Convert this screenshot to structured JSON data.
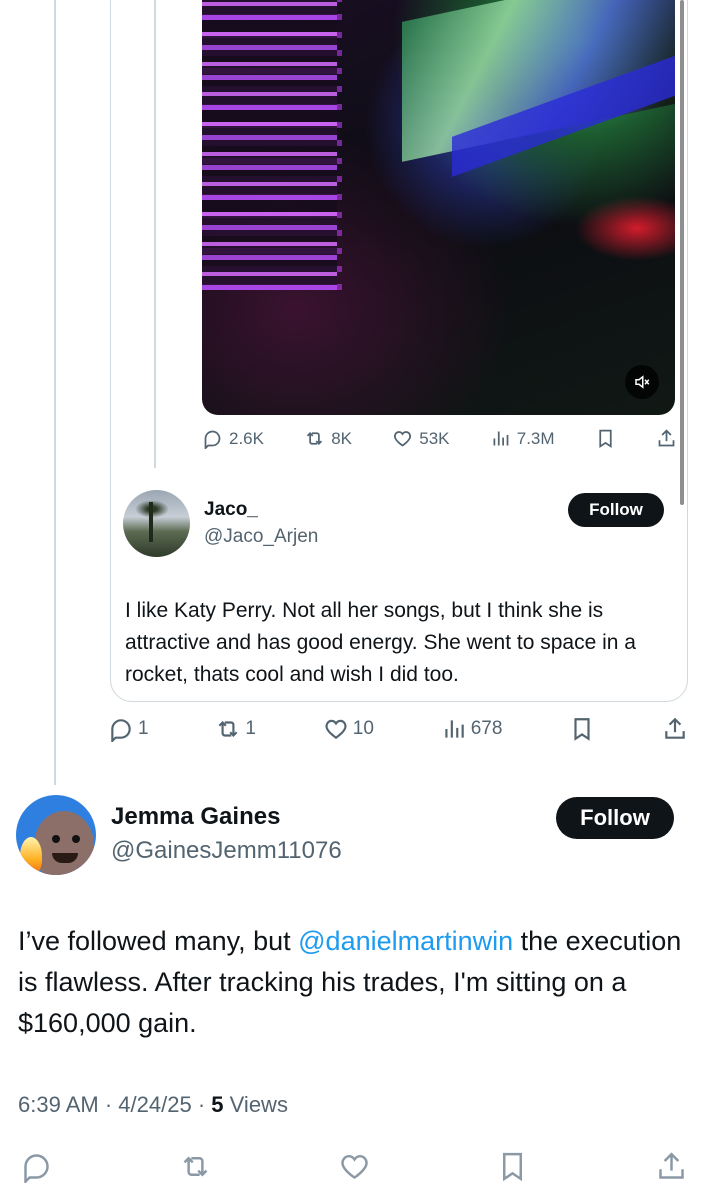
{
  "quoted_post": {
    "stats": {
      "replies": "2.6K",
      "reposts": "8K",
      "likes": "53K",
      "views": "7.3M"
    }
  },
  "reply": {
    "author": {
      "name": "Jaco_",
      "handle": "@Jaco_Arjen"
    },
    "follow_label": "Follow",
    "text": "I like Katy Perry. Not all her songs, but I think she is attractive and has good energy. She went to space in a rocket, thats cool and wish I did too.",
    "stats": {
      "replies": "1",
      "reposts": "1",
      "likes": "10",
      "views": "678"
    }
  },
  "main_post": {
    "author": {
      "name": "Jemma Gaines",
      "handle": "@GainesJemm11076"
    },
    "follow_label": "Follow",
    "text_before": "I’ve followed many, but ",
    "mention": "@danielmartinwin",
    "text_after": " the execution is flawless. After tracking his trades, I'm sitting on a $160,000 gain.",
    "time": "6:39 AM",
    "date": "4/24/25",
    "views_count": "5",
    "views_label": "Views"
  },
  "colors": {
    "text": "#0f1419",
    "secondary": "#536471",
    "accent": "#1d9bf0",
    "border": "#cfd9de"
  }
}
